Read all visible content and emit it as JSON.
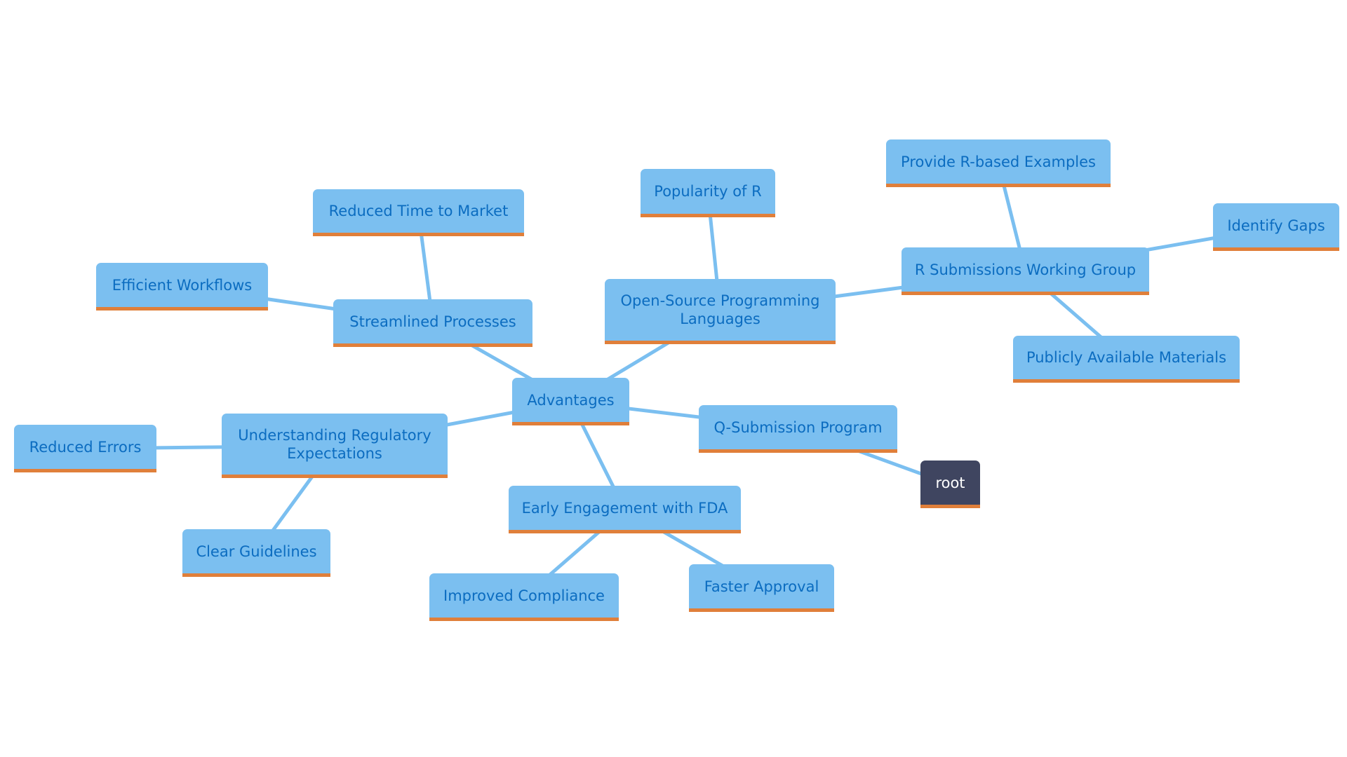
{
  "diagram": {
    "type": "mindmap",
    "colors": {
      "node_fill": "#7bbff0",
      "node_text": "#0b6cc0",
      "node_underline": "#e07f3a",
      "edge": "#7bbff0",
      "root_fill": "#3f4560",
      "root_text": "#ffffff"
    },
    "nodes": [
      {
        "id": "root",
        "label": "root"
      },
      {
        "id": "q-submission",
        "label": "Q-Submission Program"
      },
      {
        "id": "advantages",
        "label": "Advantages"
      },
      {
        "id": "streamlined",
        "label": "Streamlined Processes"
      },
      {
        "id": "reduced-time",
        "label": "Reduced Time to Market"
      },
      {
        "id": "efficient",
        "label": "Efficient Workflows"
      },
      {
        "id": "open-source",
        "label": "Open-Source Programming\nLanguages"
      },
      {
        "id": "popularity",
        "label": "Popularity of R"
      },
      {
        "id": "r-submissions",
        "label": "R Submissions Working Group"
      },
      {
        "id": "provide-r",
        "label": "Provide R-based Examples"
      },
      {
        "id": "identify-gaps",
        "label": "Identify Gaps"
      },
      {
        "id": "publicly",
        "label": "Publicly Available Materials"
      },
      {
        "id": "understanding",
        "label": "Understanding Regulatory\nExpectations"
      },
      {
        "id": "reduced-errors",
        "label": "Reduced Errors"
      },
      {
        "id": "clear-guidelines",
        "label": "Clear Guidelines"
      },
      {
        "id": "early-engagement",
        "label": "Early Engagement with FDA"
      },
      {
        "id": "improved-compliance",
        "label": "Improved Compliance"
      },
      {
        "id": "faster-approval",
        "label": "Faster Approval"
      }
    ],
    "edges": [
      [
        "root",
        "q-submission"
      ],
      [
        "q-submission",
        "advantages"
      ],
      [
        "advantages",
        "streamlined"
      ],
      [
        "streamlined",
        "reduced-time"
      ],
      [
        "streamlined",
        "efficient"
      ],
      [
        "advantages",
        "open-source"
      ],
      [
        "open-source",
        "popularity"
      ],
      [
        "open-source",
        "r-submissions"
      ],
      [
        "r-submissions",
        "provide-r"
      ],
      [
        "r-submissions",
        "identify-gaps"
      ],
      [
        "r-submissions",
        "publicly"
      ],
      [
        "advantages",
        "understanding"
      ],
      [
        "understanding",
        "reduced-errors"
      ],
      [
        "understanding",
        "clear-guidelines"
      ],
      [
        "advantages",
        "early-engagement"
      ],
      [
        "early-engagement",
        "improved-compliance"
      ],
      [
        "early-engagement",
        "faster-approval"
      ]
    ]
  }
}
